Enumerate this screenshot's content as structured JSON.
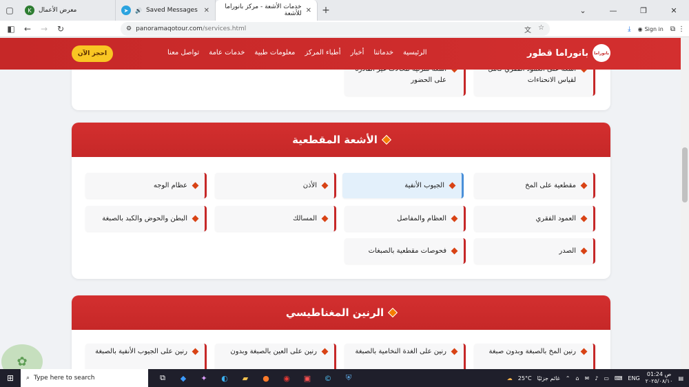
{
  "browser": {
    "tabs": [
      {
        "title": "معرض الأعمال",
        "icon": "K"
      },
      {
        "title": "Saved Messages",
        "icon": "telegram-icon"
      },
      {
        "title": "خدمات الأشعة - مركز بانوراما للأشعة",
        "icon": "site-icon"
      }
    ],
    "url_host": "panoramaqotour.com",
    "url_path": "/services.html",
    "signin": "Sign in"
  },
  "site": {
    "brand": "بانوراما قطور",
    "logo_text": "بانوراما",
    "menu": [
      "الرئيسية",
      "خدماتنا",
      "أخبار",
      "أطباء المركز",
      "معلومات طبية",
      "خدمات عامة",
      "تواصل معنا"
    ],
    "book": "احجز الآن"
  },
  "prev_section": {
    "items": [
      "أشعة على العمود الفقري كامل لقياس الانحناءات",
      "أشعة منزلية للحالات غير القادرة على الحضور"
    ]
  },
  "ct_section": {
    "title": "الأشعة المقطعية",
    "items": [
      "مقطعية على المخ",
      "الجيوب الأنفية",
      "الأذن",
      "عظام الوجه",
      "العمود الفقري",
      "العظام والمفاصل",
      "المسالك",
      "البطن والحوض والكبد بالصبغة",
      "الصدر",
      "فحوصات مقطعية بالصبغات"
    ]
  },
  "mri_section": {
    "title": "الرنين المغناطيسي",
    "items": [
      "رنين المخ بالصبغة وبدون صبغة",
      "رنين على الغدة النخامية بالصبغة",
      "رنين على العين بالصبغة وبدون",
      "رنين على الجيوب الأنفية بالصبغة"
    ]
  },
  "taskbar": {
    "search": "Type here to search",
    "weather": "25°C",
    "weather_desc": "غائم جزئيًا",
    "lang": "ENG",
    "time": "01:24 ص",
    "date": "٢٠٢٥/٠٨/١٠"
  }
}
